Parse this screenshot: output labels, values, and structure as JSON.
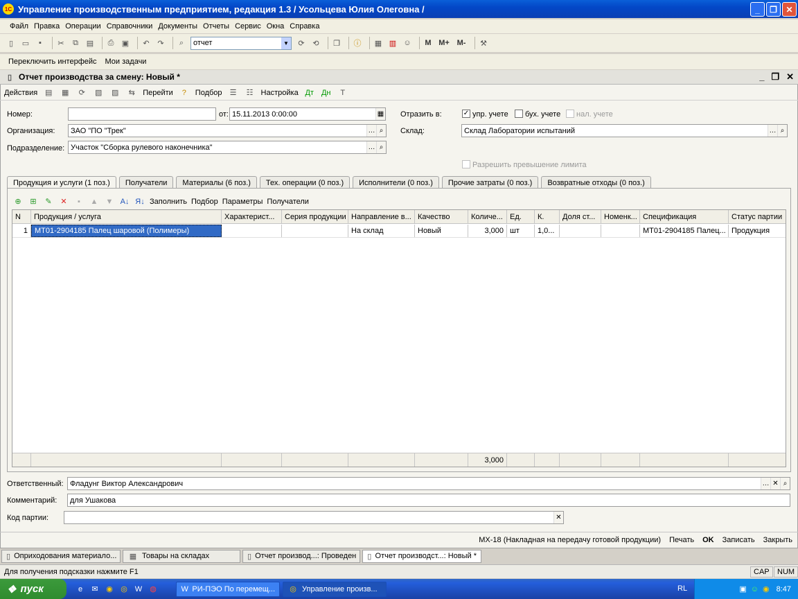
{
  "window": {
    "title": "Управление производственным предприятием, редакция 1.3 / Усольцева Юлия Олеговна /",
    "logo": "1С"
  },
  "menu": [
    "Файл",
    "Правка",
    "Операции",
    "Справочники",
    "Документы",
    "Отчеты",
    "Сервис",
    "Окна",
    "Справка"
  ],
  "toolbar": {
    "search_value": "отчет",
    "m": "M",
    "mplus": "M+",
    "mminus": "M-"
  },
  "toolbar2": {
    "switch": "Переключить интерфейс",
    "tasks": "Мои задачи"
  },
  "doc": {
    "title": "Отчет производства за смену: Новый *",
    "actions": "Действия",
    "goto": "Перейти",
    "select": "Подбор",
    "settings": "Настройка"
  },
  "form": {
    "number_label": "Номер:",
    "number_value": "",
    "from_label": "от:",
    "from_value": "15.11.2013  0:00:00",
    "reflect_label": "Отразить в:",
    "upr": "упр. учете",
    "buh": "бух. учете",
    "nal": "нал. учете",
    "org_label": "Организация:",
    "org_value": "ЗАО \"ПО \"Трек\"",
    "sklad_label": "Склад:",
    "sklad_value": "Склад Лаборатории испытаний",
    "dept_label": "Подразделение:",
    "dept_value": "Участок \"Сборка рулевого наконечника\"",
    "limit": "Разрешить превышение лимита",
    "resp_label": "Ответственный:",
    "resp_value": "Фладунг Виктор Александрович",
    "comment_label": "Комментарий:",
    "comment_value": "для Ушакова",
    "batch_label": "Код партии:",
    "batch_value": ""
  },
  "tabs": [
    "Продукция и услуги (1 поз.)",
    "Получатели",
    "Материалы (6 поз.)",
    "Тех. операции (0 поз.)",
    "Исполнители (0 поз.)",
    "Прочие затраты (0 поз.)",
    "Возвратные отходы (0 поз.)"
  ],
  "grid_toolbar": {
    "fill": "Заполнить",
    "select": "Подбор",
    "params": "Параметры",
    "recipients": "Получатели"
  },
  "columns": [
    "N",
    "Продукция / услуга",
    "Характерист...",
    "Серия продукции",
    "Направление в...",
    "Качество",
    "Количе...",
    "Ед.",
    "К.",
    "Доля ст...",
    "Номенк...",
    "Спецификация",
    "Статус партии"
  ],
  "rows": [
    [
      "1",
      "МТ01-2904185 Палец шаровой (Полимеры)",
      "",
      "",
      "На склад",
      "Новый",
      "3,000",
      "шт",
      "1,0...",
      "",
      "",
      "МТ01-2904185 Палец...",
      "Продукция"
    ]
  ],
  "footer_total": "3,000",
  "bottom": {
    "print_form": "МХ-18 (Накладная на передачу готовой продукции)",
    "print": "Печать",
    "ok": "OK",
    "save": "Записать",
    "close": "Закрыть"
  },
  "windows": [
    "Оприходования материало...",
    "Товары на складах",
    "Отчет производ...: Проведен",
    "Отчет производст...: Новый *"
  ],
  "status": {
    "hint": "Для получения подсказки нажмите F1",
    "cap": "CAP",
    "num": "NUM"
  },
  "taskbar": {
    "start": "пуск",
    "tasks": [
      "РИ-ПЭО По перемещ...",
      "Управление произв..."
    ],
    "lang": "RL",
    "time": "8:47"
  }
}
